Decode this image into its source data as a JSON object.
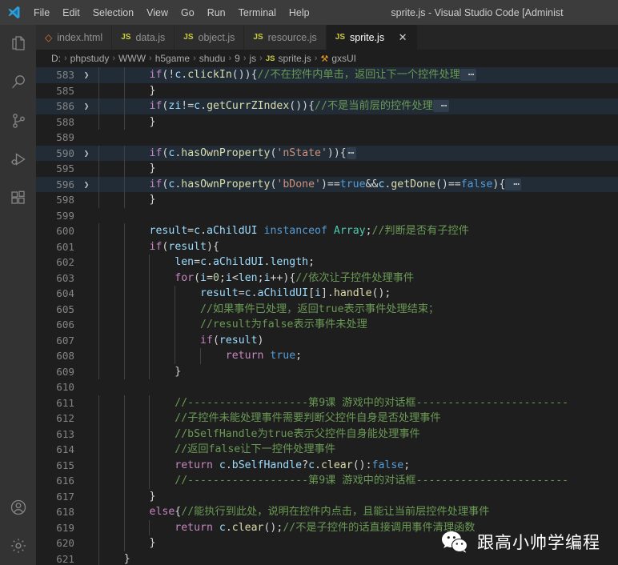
{
  "titlebar": {
    "logo_icon": "vscode-logo-icon",
    "window_title": "sprite.js - Visual Studio Code [Administ",
    "menus": [
      {
        "label": "File"
      },
      {
        "label": "Edit"
      },
      {
        "label": "Selection"
      },
      {
        "label": "View"
      },
      {
        "label": "Go"
      },
      {
        "label": "Run"
      },
      {
        "label": "Terminal"
      },
      {
        "label": "Help"
      }
    ]
  },
  "activitybar": {
    "top_items": [
      {
        "name": "explorer",
        "icon": "files-icon"
      },
      {
        "name": "search",
        "icon": "search-icon"
      },
      {
        "name": "source-control",
        "icon": "source-control-icon"
      },
      {
        "name": "run-and-debug",
        "icon": "run-debug-icon"
      },
      {
        "name": "extensions",
        "icon": "extensions-icon"
      }
    ],
    "bottom_items": [
      {
        "name": "accounts",
        "icon": "account-icon"
      },
      {
        "name": "manage",
        "icon": "gear-icon"
      }
    ]
  },
  "tabs": [
    {
      "label": "index.html",
      "icon": "html-file-icon",
      "icon_glyph": "◇",
      "kind": "html",
      "active": false,
      "closable": false
    },
    {
      "label": "data.js",
      "icon": "js-file-icon",
      "icon_glyph": "JS",
      "kind": "js",
      "active": false,
      "closable": false
    },
    {
      "label": "object.js",
      "icon": "js-file-icon",
      "icon_glyph": "JS",
      "kind": "js",
      "active": false,
      "closable": false
    },
    {
      "label": "resource.js",
      "icon": "js-file-icon",
      "icon_glyph": "JS",
      "kind": "js",
      "active": false,
      "closable": false
    },
    {
      "label": "sprite.js",
      "icon": "js-file-icon",
      "icon_glyph": "JS",
      "kind": "js",
      "active": true,
      "closable": true,
      "close_glyph": "✕"
    }
  ],
  "breadcrumbs": {
    "separator": "›",
    "segments": [
      {
        "label": "D:",
        "icon": null
      },
      {
        "label": "phpstudy",
        "icon": null
      },
      {
        "label": "WWW",
        "icon": null
      },
      {
        "label": "h5game",
        "icon": null
      },
      {
        "label": "shudu",
        "icon": null
      },
      {
        "label": "9",
        "icon": null
      },
      {
        "label": "js",
        "icon": null
      },
      {
        "label": "sprite.js",
        "icon": "js-file-icon",
        "icon_glyph": "JS"
      },
      {
        "label": "gxsUI",
        "icon": "symbol-class-icon",
        "icon_glyph": "⚒"
      }
    ]
  },
  "editor": {
    "fold_ellipsis": "⋯",
    "chevron_glyph": "❯",
    "lines": [
      {
        "num": "583",
        "folded": true,
        "fold_marker": true,
        "tokens": [
          {
            "t": "        ",
            "c": "t-pun"
          },
          {
            "t": "if",
            "c": "t-kw"
          },
          {
            "t": "(!",
            "c": "t-pun"
          },
          {
            "t": "c",
            "c": "t-var"
          },
          {
            "t": ".",
            "c": "t-pun"
          },
          {
            "t": "clickIn",
            "c": "t-fn"
          },
          {
            "t": "()){",
            "c": "t-pun"
          },
          {
            "t": "//不在控件内单击，返回让下一个控件处理",
            "c": "t-cmt"
          },
          {
            "t": " ⋯",
            "c": "t-fold"
          }
        ]
      },
      {
        "num": "585",
        "folded": false,
        "fold_marker": false,
        "tokens": [
          {
            "t": "        }",
            "c": "t-pun"
          }
        ]
      },
      {
        "num": "586",
        "folded": true,
        "fold_marker": true,
        "tokens": [
          {
            "t": "        ",
            "c": "t-pun"
          },
          {
            "t": "if",
            "c": "t-kw"
          },
          {
            "t": "(",
            "c": "t-pun"
          },
          {
            "t": "zi",
            "c": "t-var"
          },
          {
            "t": "!=",
            "c": "t-pun"
          },
          {
            "t": "c",
            "c": "t-var"
          },
          {
            "t": ".",
            "c": "t-pun"
          },
          {
            "t": "getCurrZIndex",
            "c": "t-fn"
          },
          {
            "t": "()){",
            "c": "t-pun"
          },
          {
            "t": "//不是当前层的控件处理",
            "c": "t-cmt"
          },
          {
            "t": " ⋯",
            "c": "t-fold"
          }
        ]
      },
      {
        "num": "588",
        "folded": false,
        "fold_marker": false,
        "tokens": [
          {
            "t": "        }",
            "c": "t-pun"
          }
        ]
      },
      {
        "num": "589",
        "folded": false,
        "fold_marker": false,
        "tokens": []
      },
      {
        "num": "590",
        "folded": true,
        "fold_marker": true,
        "tokens": [
          {
            "t": "        ",
            "c": "t-pun"
          },
          {
            "t": "if",
            "c": "t-kw"
          },
          {
            "t": "(",
            "c": "t-pun"
          },
          {
            "t": "c",
            "c": "t-var"
          },
          {
            "t": ".",
            "c": "t-pun"
          },
          {
            "t": "hasOwnProperty",
            "c": "t-fn"
          },
          {
            "t": "(",
            "c": "t-pun"
          },
          {
            "t": "'nState'",
            "c": "t-str"
          },
          {
            "t": ")){",
            "c": "t-pun"
          },
          {
            "t": "⋯",
            "c": "t-fold"
          }
        ]
      },
      {
        "num": "595",
        "folded": false,
        "fold_marker": false,
        "tokens": [
          {
            "t": "        }",
            "c": "t-pun"
          }
        ]
      },
      {
        "num": "596",
        "folded": true,
        "fold_marker": true,
        "tokens": [
          {
            "t": "        ",
            "c": "t-pun"
          },
          {
            "t": "if",
            "c": "t-kw"
          },
          {
            "t": "(",
            "c": "t-pun"
          },
          {
            "t": "c",
            "c": "t-var"
          },
          {
            "t": ".",
            "c": "t-pun"
          },
          {
            "t": "hasOwnProperty",
            "c": "t-fn"
          },
          {
            "t": "(",
            "c": "t-pun"
          },
          {
            "t": "'bDone'",
            "c": "t-str"
          },
          {
            "t": ")==",
            "c": "t-pun"
          },
          {
            "t": "true",
            "c": "t-ctl"
          },
          {
            "t": "&&",
            "c": "t-pun"
          },
          {
            "t": "c",
            "c": "t-var"
          },
          {
            "t": ".",
            "c": "t-pun"
          },
          {
            "t": "getDone",
            "c": "t-fn"
          },
          {
            "t": "()==",
            "c": "t-pun"
          },
          {
            "t": "false",
            "c": "t-ctl"
          },
          {
            "t": "){",
            "c": "t-pun"
          },
          {
            "t": " ⋯",
            "c": "t-fold"
          }
        ]
      },
      {
        "num": "598",
        "folded": false,
        "fold_marker": false,
        "tokens": [
          {
            "t": "        }",
            "c": "t-pun"
          }
        ]
      },
      {
        "num": "599",
        "folded": false,
        "fold_marker": false,
        "tokens": []
      },
      {
        "num": "600",
        "folded": false,
        "fold_marker": false,
        "tokens": [
          {
            "t": "        ",
            "c": "t-pun"
          },
          {
            "t": "result",
            "c": "t-var"
          },
          {
            "t": "=",
            "c": "t-pun"
          },
          {
            "t": "c",
            "c": "t-var"
          },
          {
            "t": ".",
            "c": "t-pun"
          },
          {
            "t": "aChildUI",
            "c": "t-var"
          },
          {
            "t": " ",
            "c": "t-pun"
          },
          {
            "t": "instanceof",
            "c": "t-ctl"
          },
          {
            "t": " ",
            "c": "t-pun"
          },
          {
            "t": "Array",
            "c": "t-type"
          },
          {
            "t": ";",
            "c": "t-pun"
          },
          {
            "t": "//判断是否有子控件",
            "c": "t-cmt"
          }
        ]
      },
      {
        "num": "601",
        "folded": false,
        "fold_marker": false,
        "tokens": [
          {
            "t": "        ",
            "c": "t-pun"
          },
          {
            "t": "if",
            "c": "t-kw"
          },
          {
            "t": "(",
            "c": "t-pun"
          },
          {
            "t": "result",
            "c": "t-var"
          },
          {
            "t": "){",
            "c": "t-pun"
          }
        ]
      },
      {
        "num": "602",
        "folded": false,
        "fold_marker": false,
        "tokens": [
          {
            "t": "            ",
            "c": "t-pun"
          },
          {
            "t": "len",
            "c": "t-var"
          },
          {
            "t": "=",
            "c": "t-pun"
          },
          {
            "t": "c",
            "c": "t-var"
          },
          {
            "t": ".",
            "c": "t-pun"
          },
          {
            "t": "aChildUI",
            "c": "t-var"
          },
          {
            "t": ".",
            "c": "t-pun"
          },
          {
            "t": "length",
            "c": "t-var"
          },
          {
            "t": ";",
            "c": "t-pun"
          }
        ]
      },
      {
        "num": "603",
        "folded": false,
        "fold_marker": false,
        "tokens": [
          {
            "t": "            ",
            "c": "t-pun"
          },
          {
            "t": "for",
            "c": "t-kw"
          },
          {
            "t": "(",
            "c": "t-pun"
          },
          {
            "t": "i",
            "c": "t-var"
          },
          {
            "t": "=",
            "c": "t-pun"
          },
          {
            "t": "0",
            "c": "t-num"
          },
          {
            "t": ";",
            "c": "t-pun"
          },
          {
            "t": "i",
            "c": "t-var"
          },
          {
            "t": "<",
            "c": "t-pun"
          },
          {
            "t": "len",
            "c": "t-var"
          },
          {
            "t": ";",
            "c": "t-pun"
          },
          {
            "t": "i",
            "c": "t-var"
          },
          {
            "t": "++){",
            "c": "t-pun"
          },
          {
            "t": "//依次让子控件处理事件",
            "c": "t-cmt"
          }
        ]
      },
      {
        "num": "604",
        "folded": false,
        "fold_marker": false,
        "tokens": [
          {
            "t": "                ",
            "c": "t-pun"
          },
          {
            "t": "result",
            "c": "t-var"
          },
          {
            "t": "=",
            "c": "t-pun"
          },
          {
            "t": "c",
            "c": "t-var"
          },
          {
            "t": ".",
            "c": "t-pun"
          },
          {
            "t": "aChildUI",
            "c": "t-var"
          },
          {
            "t": "[",
            "c": "t-pun"
          },
          {
            "t": "i",
            "c": "t-var"
          },
          {
            "t": "].",
            "c": "t-pun"
          },
          {
            "t": "handle",
            "c": "t-fn"
          },
          {
            "t": "();",
            "c": "t-pun"
          }
        ]
      },
      {
        "num": "605",
        "folded": false,
        "fold_marker": false,
        "tokens": [
          {
            "t": "                ",
            "c": "t-pun"
          },
          {
            "t": "//如果事件已处理，返回true表示事件处理结束；",
            "c": "t-cmt"
          }
        ]
      },
      {
        "num": "606",
        "folded": false,
        "fold_marker": false,
        "tokens": [
          {
            "t": "                ",
            "c": "t-pun"
          },
          {
            "t": "//result为false表示事件未处理",
            "c": "t-cmt"
          }
        ]
      },
      {
        "num": "607",
        "folded": false,
        "fold_marker": false,
        "tokens": [
          {
            "t": "                ",
            "c": "t-pun"
          },
          {
            "t": "if",
            "c": "t-kw"
          },
          {
            "t": "(",
            "c": "t-pun"
          },
          {
            "t": "result",
            "c": "t-var"
          },
          {
            "t": ")",
            "c": "t-pun"
          }
        ]
      },
      {
        "num": "608",
        "folded": false,
        "fold_marker": false,
        "tokens": [
          {
            "t": "                    ",
            "c": "t-pun"
          },
          {
            "t": "return",
            "c": "t-kw"
          },
          {
            "t": " ",
            "c": "t-pun"
          },
          {
            "t": "true",
            "c": "t-ctl"
          },
          {
            "t": ";",
            "c": "t-pun"
          }
        ]
      },
      {
        "num": "609",
        "folded": false,
        "fold_marker": false,
        "tokens": [
          {
            "t": "            }",
            "c": "t-pun"
          }
        ]
      },
      {
        "num": "610",
        "folded": false,
        "fold_marker": false,
        "tokens": []
      },
      {
        "num": "611",
        "folded": false,
        "fold_marker": false,
        "tokens": [
          {
            "t": "            ",
            "c": "t-pun"
          },
          {
            "t": "//-------------------第9课 游戏中的对话框------------------------",
            "c": "t-cmt"
          }
        ]
      },
      {
        "num": "612",
        "folded": false,
        "fold_marker": false,
        "tokens": [
          {
            "t": "            ",
            "c": "t-pun"
          },
          {
            "t": "//子控件未能处理事件需要判断父控件自身是否处理事件",
            "c": "t-cmt"
          }
        ]
      },
      {
        "num": "613",
        "folded": false,
        "fold_marker": false,
        "tokens": [
          {
            "t": "            ",
            "c": "t-pun"
          },
          {
            "t": "//bSelfHandle为true表示父控件自身能处理事件",
            "c": "t-cmt"
          }
        ]
      },
      {
        "num": "614",
        "folded": false,
        "fold_marker": false,
        "tokens": [
          {
            "t": "            ",
            "c": "t-pun"
          },
          {
            "t": "//返回false让下一控件处理事件",
            "c": "t-cmt"
          }
        ]
      },
      {
        "num": "615",
        "folded": false,
        "fold_marker": false,
        "tokens": [
          {
            "t": "            ",
            "c": "t-pun"
          },
          {
            "t": "return",
            "c": "t-kw"
          },
          {
            "t": " ",
            "c": "t-pun"
          },
          {
            "t": "c",
            "c": "t-var"
          },
          {
            "t": ".",
            "c": "t-pun"
          },
          {
            "t": "bSelfHandle",
            "c": "t-var"
          },
          {
            "t": "?",
            "c": "t-pun"
          },
          {
            "t": "c",
            "c": "t-var"
          },
          {
            "t": ".",
            "c": "t-pun"
          },
          {
            "t": "clear",
            "c": "t-fn"
          },
          {
            "t": "():",
            "c": "t-pun"
          },
          {
            "t": "false",
            "c": "t-ctl"
          },
          {
            "t": ";",
            "c": "t-pun"
          }
        ]
      },
      {
        "num": "616",
        "folded": false,
        "fold_marker": false,
        "tokens": [
          {
            "t": "            ",
            "c": "t-pun"
          },
          {
            "t": "//-------------------第9课 游戏中的对话框------------------------",
            "c": "t-cmt"
          }
        ]
      },
      {
        "num": "617",
        "folded": false,
        "fold_marker": false,
        "tokens": [
          {
            "t": "        }",
            "c": "t-pun"
          }
        ]
      },
      {
        "num": "618",
        "folded": false,
        "fold_marker": false,
        "tokens": [
          {
            "t": "        ",
            "c": "t-pun"
          },
          {
            "t": "else",
            "c": "t-kw"
          },
          {
            "t": "{",
            "c": "t-pun"
          },
          {
            "t": "//能执行到此处，说明在控件内点击，且能让当前层控件处理事件",
            "c": "t-cmt"
          }
        ]
      },
      {
        "num": "619",
        "folded": false,
        "fold_marker": false,
        "tokens": [
          {
            "t": "            ",
            "c": "t-pun"
          },
          {
            "t": "return",
            "c": "t-kw"
          },
          {
            "t": " ",
            "c": "t-pun"
          },
          {
            "t": "c",
            "c": "t-var"
          },
          {
            "t": ".",
            "c": "t-pun"
          },
          {
            "t": "clear",
            "c": "t-fn"
          },
          {
            "t": "();",
            "c": "t-pun"
          },
          {
            "t": "//不是子控件的话直接调用事件清理函数",
            "c": "t-cmt"
          }
        ]
      },
      {
        "num": "620",
        "folded": false,
        "fold_marker": false,
        "tokens": [
          {
            "t": "        }",
            "c": "t-pun"
          }
        ]
      },
      {
        "num": "621",
        "folded": false,
        "fold_marker": false,
        "tokens": [
          {
            "t": "    }",
            "c": "t-pun"
          }
        ]
      }
    ]
  },
  "watermark": {
    "icon": "wechat-icon",
    "text": "跟高小帅学编程"
  },
  "colors": {
    "titlebar_bg": "#3c3c3c",
    "activitybar_bg": "#333333",
    "tabbar_bg": "#252526",
    "tab_inactive_bg": "#2d2d2d",
    "editor_bg": "#1e1e1e",
    "folded_line_bg": "#212c36",
    "comment": "#6a9955",
    "keyword": "#c586c0",
    "string": "#ce9178",
    "function": "#dcdcaa",
    "variable": "#9cdcfe",
    "js_icon": "#cbcb41",
    "html_icon": "#e37933"
  }
}
